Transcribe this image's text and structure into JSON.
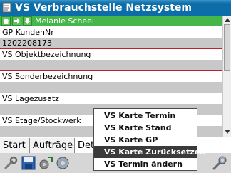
{
  "app": {
    "title": "VS Verbrauchstelle Netzsystem"
  },
  "navbar": {
    "user_name": "Melanie Scheel"
  },
  "fields": [
    {
      "label": "GP KundenNr",
      "value": "1202208173"
    },
    {
      "label": "VS Objektbezeichnung",
      "value": ""
    },
    {
      "label": "VS Sonderbezeichnung",
      "value": ""
    },
    {
      "label": "VS Lagezusatz",
      "value": ""
    },
    {
      "label": "VS Etage/Stockwerk",
      "value": ""
    }
  ],
  "tabs": [
    "Start",
    "Aufträge",
    "Det"
  ],
  "context_menu": {
    "items": [
      "VS Karte Termin",
      "VS Karte Stand",
      "VS Karte GP",
      "VS Karte Zurücksetzen",
      "VS Termin ändern"
    ],
    "selected_index": 3
  },
  "toolbar": {
    "icons": [
      "wrench-icon",
      "save-icon",
      "gear-arrows-icon",
      "gear-icon",
      "settings-tools-icon"
    ]
  },
  "colors": {
    "titlebar": "#0c6da8",
    "navbar": "#44b64a",
    "separator": "#c0202a",
    "menu_selected": "#3a3a3a"
  }
}
